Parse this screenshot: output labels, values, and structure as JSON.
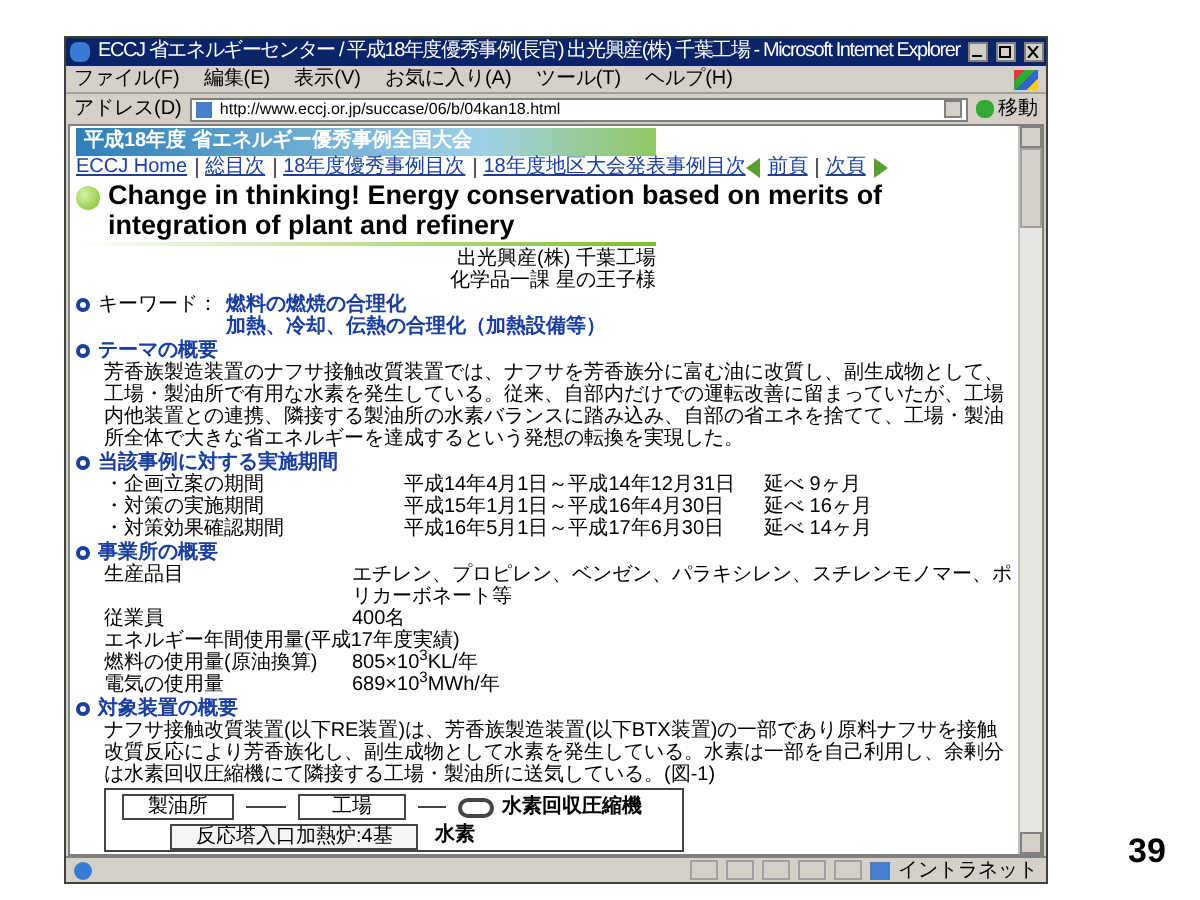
{
  "window": {
    "title": "ECCJ 省エネルギーセンター / 平成18年度優秀事例(長官) 出光興産(株) 千葉工場 - Microsoft Internet Explorer"
  },
  "menu": [
    "ファイル(F)",
    "編集(E)",
    "表示(V)",
    "お気に入り(A)",
    "ツール(T)",
    "ヘルプ(H)"
  ],
  "address_bar": {
    "label": "アドレス(D)",
    "url": "http://www.eccj.or.jp/succase/06/b/04kan18.html",
    "go": "移動"
  },
  "page": {
    "banner": "平成18年度 省エネルギー優秀事例全国大会",
    "nav_links": [
      "ECCJ Home",
      "総目次",
      "18年度優秀事例目次",
      "18年度地区大会発表事例目次"
    ],
    "pager": [
      "前頁",
      "次頁"
    ],
    "heading": "Change in thinking! Energy conservation based on merits of integration of plant and refinery",
    "author": [
      "出光興産(株) 千葉工場",
      "化学品一課 星の王子様"
    ],
    "keywords": {
      "label": "キーワード：",
      "lines": [
        "燃料の燃焼の合理化",
        "加熱、冷却、伝熱の合理化（加熱設備等）"
      ]
    },
    "sections": [
      {
        "kind": "paragraph",
        "title": "テーマの概要",
        "text": "芳香族製造装置のナフサ接触改質装置では、ナフサを芳香族分に富む油に改質し、副生成物として、工場・製油所で有用な水素を発生している。従来、自部内だけでの運転改善に留まっていたが、工場内他装置との連携、隣接する製油所の水素バランスに踏み込み、自部の省エネを捨てて、工場・製油所全体で大きな省エネルギーを達成するという発想の転換を実現した。"
      },
      {
        "kind": "table",
        "title": "当該事例に対する実施期間",
        "rows": [
          [
            "・企画立案の期間",
            "平成14年4月1日～平成14年12月31日",
            "延べ 9ヶ月"
          ],
          [
            "・対策の実施期間",
            "平成15年1月1日～平成16年4月30日",
            "延べ 16ヶ月"
          ],
          [
            "・対策効果確認期間",
            "平成16年5月1日～平成17年6月30日",
            "延べ 14ヶ月"
          ]
        ]
      },
      {
        "kind": "table",
        "title": "事業所の概要",
        "rows": [
          [
            "生産品目",
            "エチレン、プロピレン、ベンゼン、パラキシレン、スチレンモノマー、ポリカーボネート等"
          ],
          [
            "従業員",
            "400名"
          ],
          [
            "エネルギー年間使用量(平成17年度実績)"
          ],
          [
            "燃料の使用量(原油換算)",
            "805×10$^{3}$KL/年"
          ],
          [
            "電気の使用量",
            "689×10$^{3}$MWh/年"
          ]
        ]
      },
      {
        "kind": "paragraph",
        "title": "対象装置の概要",
        "text": "ナフサ接触改質装置(以下RE装置)は、芳香族製造装置(以下BTX装置)の一部であり原料ナフサを接触改質反応により芳香族化し、副生成物として水素を発生している。水素は一部を自己利用し、余剰分は水素回収圧縮機にて隣接する工場・製油所に送気している。(図-1)"
      }
    ],
    "diagram": {
      "refinery": "製油所",
      "plant": "工場",
      "compressor": "水素回収圧縮機",
      "furnace": "反応塔入口加熱炉:4基",
      "hydrogen": "水素"
    }
  },
  "status_bar": {
    "zone": "イントラネット"
  },
  "slide_number": "39"
}
